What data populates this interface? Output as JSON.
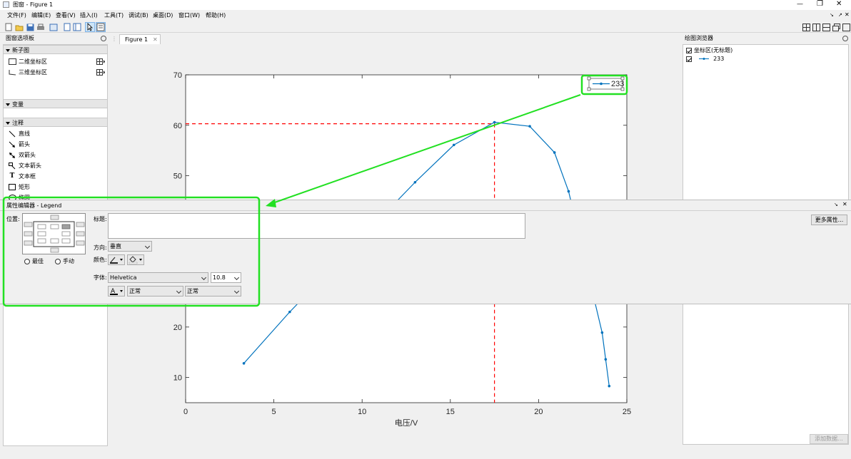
{
  "window": {
    "title": "图窗 - Figure 1",
    "controls": [
      "—",
      "❐",
      "✕"
    ]
  },
  "menu": [
    "文件(F)",
    "编辑(E)",
    "查看(V)",
    "插入(I)",
    "工具(T)",
    "调试(B)",
    "桌面(D)",
    "窗口(W)",
    "帮助(H)"
  ],
  "palette": {
    "title": "图窗选项板",
    "new_subplot": {
      "header": "新子图",
      "items": [
        "二维坐标区",
        "三维坐标区"
      ]
    },
    "variables": {
      "header": "变量"
    },
    "annotations": {
      "header": "注释",
      "items": [
        "直线",
        "箭头",
        "双箭头",
        "文本箭头",
        "文本框",
        "矩形",
        "椭圆"
      ]
    }
  },
  "figure_tab": {
    "label": "Figure 1",
    "close": "✕"
  },
  "browser": {
    "title": "绘图浏览器",
    "items": [
      "坐标区(无标题)",
      "233"
    ],
    "add_data_button": "添加数据..."
  },
  "property_editor": {
    "title": "属性编辑器 - Legend",
    "position_label": "位置:",
    "radio_best": "最佳",
    "radio_manual": "手动",
    "title_label": "标题:",
    "title_value": "",
    "orientation_label": "方向:",
    "orientation_value": "垂直",
    "color_label": "颜色:",
    "font_label": "字体:",
    "font_name": "Helvetica",
    "font_size": "10.8",
    "font_weight": "正常",
    "font_angle": "正常",
    "more_props_button": "更多属性..."
  },
  "colors": {
    "series": "#0072bd",
    "dashed": "#ff0000",
    "highlight": "#22e022"
  },
  "chart_data": {
    "type": "line",
    "xlabel": "电压/V",
    "ylabel": "",
    "title": "",
    "xlim": [
      0,
      25
    ],
    "ylim": [
      5,
      70
    ],
    "xticks": [
      0,
      5,
      10,
      15,
      20,
      25
    ],
    "yticks": [
      10,
      20,
      50,
      60,
      70
    ],
    "legend": {
      "entries": [
        "233"
      ],
      "placement": "top-right"
    },
    "series": [
      {
        "name": "233",
        "x": [
          3.3,
          5.9,
          13.0,
          15.2,
          17.5,
          19.5,
          20.9,
          21.7,
          23.6,
          23.8,
          24.0
        ],
        "y": [
          12.8,
          23.0,
          48.7,
          56.1,
          60.6,
          59.8,
          54.6,
          46.9,
          18.9,
          13.6,
          8.3
        ]
      }
    ],
    "reference_lines": {
      "x": 17.5,
      "y": 60.3
    }
  }
}
